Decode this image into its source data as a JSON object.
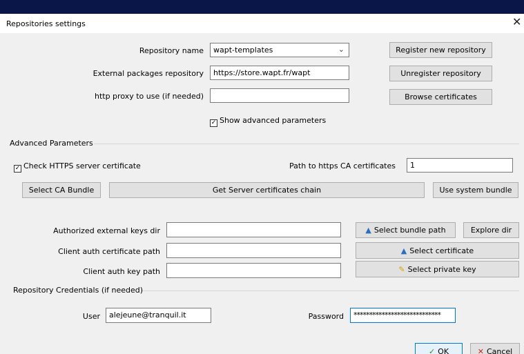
{
  "dialog": {
    "title": "Repositories settings"
  },
  "repository": {
    "name_label": "Repository name",
    "name_value": "wapt-templates",
    "external_label": "External packages repository",
    "external_value": "https://store.wapt.fr/wapt",
    "proxy_label": "http proxy to use (if needed)",
    "proxy_value": "",
    "show_advanced_label": "Show advanced parameters"
  },
  "buttons": {
    "register": "Register new repository",
    "unregister": "Unregister repository",
    "browse_certs": "Browse certificates",
    "select_ca_bundle": "Select CA Bundle",
    "get_chain": "Get Server certificates chain",
    "use_system_bundle": "Use system bundle",
    "select_bundle_path": "Select bundle path",
    "explore_dir": "Explore dir",
    "select_certificate": "Select certificate",
    "select_private_key": "Select private key",
    "ok": "OK",
    "cancel": "Cancel"
  },
  "advanced": {
    "section_label": "Advanced Parameters",
    "check_https_label": "Check HTTPS server certificate",
    "ca_path_label": "Path to https CA certificates",
    "ca_path_value": "1",
    "auth_keys_label": "Authorized external keys dir",
    "client_cert_label": "Client auth certificate path",
    "client_key_label": "Client auth key path"
  },
  "credentials": {
    "section_label": "Repository Credentials (if needed)",
    "user_label": "User",
    "user_value": "alejeune@tranquil.it",
    "password_label": "Password",
    "password_value": "****************************"
  },
  "icons": {
    "bundle": "folder-arrow-icon",
    "certificate": "certificate-icon",
    "key": "key-icon",
    "close": "close-icon",
    "ok": "check-icon",
    "cancel": "x-icon"
  },
  "colors": {
    "background": "#0b1648",
    "dialog": "#f0f0f0",
    "button": "#e1e1e1",
    "focus_border": "#0078d7"
  }
}
